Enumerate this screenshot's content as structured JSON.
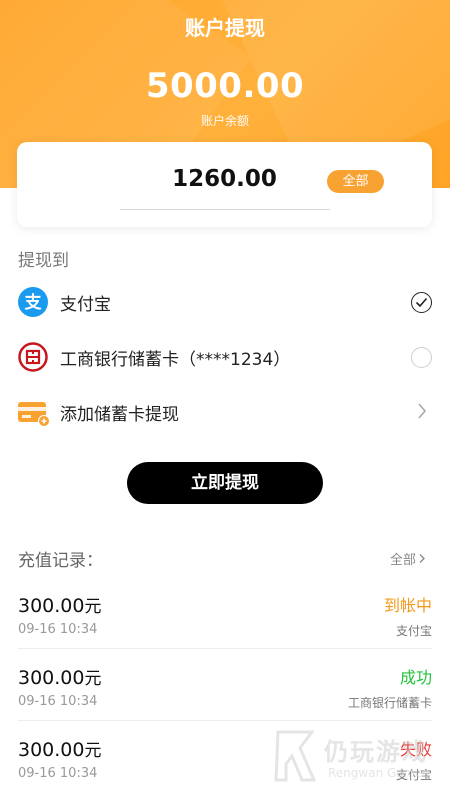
{
  "header": {
    "title": "账户提现",
    "balance": "5000.00",
    "balance_label": "账户余额"
  },
  "withdraw": {
    "amount": "1260.00",
    "all_label": "全部"
  },
  "methods": {
    "title": "提现到",
    "items": [
      {
        "label": "支付宝",
        "icon": "alipay-icon",
        "selected": true
      },
      {
        "label": "工商银行储蓄卡（****1234）",
        "icon": "icbc-icon",
        "selected": false
      },
      {
        "label": "添加储蓄卡提现",
        "icon": "add-card-icon"
      }
    ]
  },
  "submit_label": "立即提现",
  "records": {
    "title": "充值记录：",
    "all_label": "全部",
    "items": [
      {
        "amount": "300.00",
        "unit": "元",
        "time": "09-16 10:34",
        "status": "到帐中",
        "status_color": "#f39a1e",
        "dest": "支付宝"
      },
      {
        "amount": "300.00",
        "unit": "元",
        "time": "09-16 10:34",
        "status": "成功",
        "status_color": "#22c23a",
        "dest": "工商银行储蓄卡"
      },
      {
        "amount": "300.00",
        "unit": "元",
        "time": "09-16 10:34",
        "status": "失败",
        "status_color": "#e53935",
        "dest": "支付宝"
      }
    ]
  },
  "watermark": {
    "text": "仍玩游戏",
    "sub": "Rengwan Games"
  },
  "colors": {
    "accent": "#ffa52a",
    "button": "#000000"
  }
}
